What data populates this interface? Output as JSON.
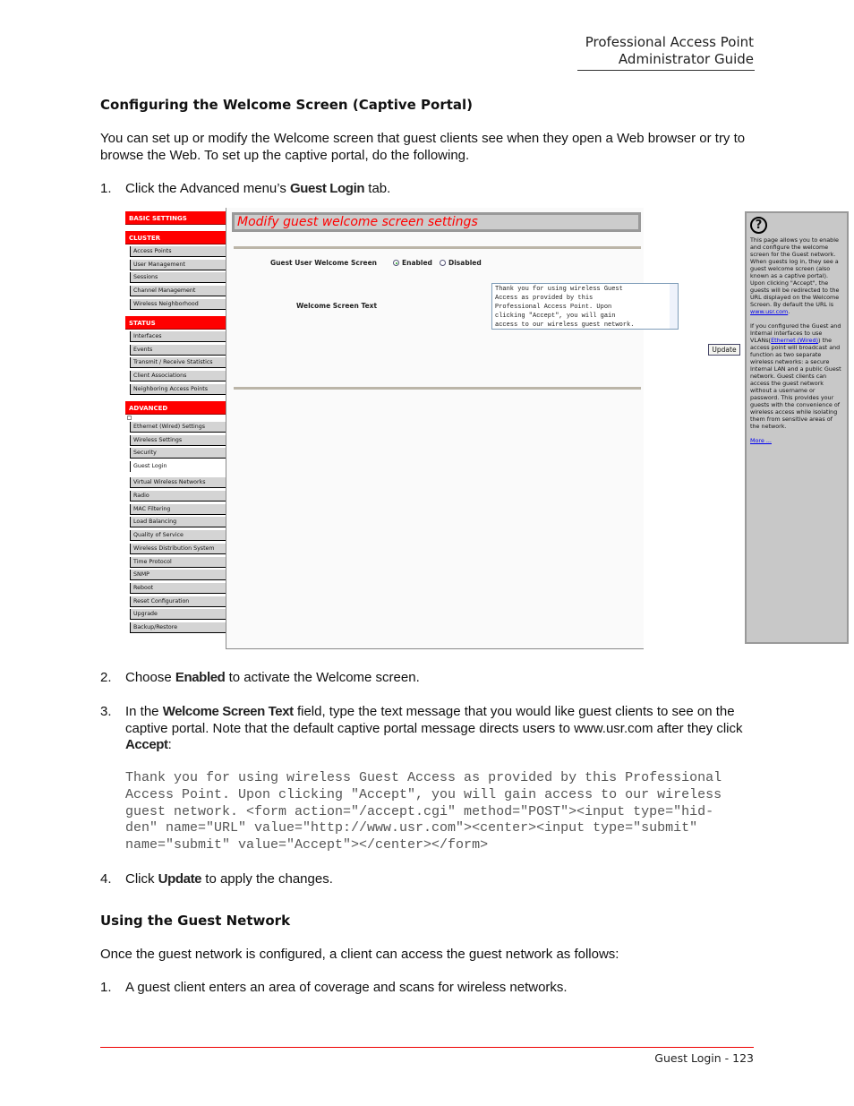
{
  "header": {
    "line1": "Professional Access Point",
    "line2": "Administrator Guide"
  },
  "section1": {
    "title": "Configuring the Welcome Screen (Captive Portal)",
    "intro": "You can set up or modify the Welcome screen that guest clients see when they open a Web browser or try to browse the Web. To set up the captive portal, do the following."
  },
  "steps": [
    {
      "num": "1.",
      "pre": "Click the Advanced menu’s ",
      "kw": "Guest Login",
      "post": " tab."
    },
    {
      "num": "2.",
      "pre": "Choose ",
      "kw": "Enabled",
      "post": " to activate the Welcome screen."
    },
    {
      "num": "3.",
      "pre": "In the ",
      "kw": "Welcome Screen Text",
      "mid": " field, type the text message that you would like guest clients to see on the captive portal. Note that the default captive portal message directs users to www.usr.com after they click ",
      "kw2": "Accept",
      "post": ":"
    },
    {
      "num": "4.",
      "pre": "Click ",
      "kw": "Update",
      "post": " to apply the changes."
    }
  ],
  "code": "Thank you for using wireless Guest Access as provided by this Professional\nAccess Point. Upon clicking \"Accept\", you will gain access to our wireless\nguest network. <form action=\"/accept.cgi\" method=\"POST\"><input type=\"hid-\nden\" name=\"URL\" value=\"http://www.usr.com\"><center><input type=\"submit\"\nname=\"submit\" value=\"Accept\"></center></form>",
  "section2": {
    "title": "Using the Guest Network",
    "intro": "Once the guest network is configured, a client can access the guest network as follows:",
    "step1_num": "1.",
    "step1": "A guest client enters an area of coverage and scans for wireless networks."
  },
  "footer": "Guest Login - 123",
  "screenshot": {
    "sidebar": {
      "basic": "BASIC SETTINGS",
      "cluster": "CLUSTER",
      "cluster_items": [
        "Access Points",
        "User Management",
        "Sessions",
        "Channel Management",
        "Wireless Neighborhood"
      ],
      "status": "STATUS",
      "status_items": [
        "Interfaces",
        "Events",
        "Transmit / Receive Statistics",
        "Client Associations",
        "Neighboring Access Points"
      ],
      "advanced": "ADVANCED",
      "advanced_items": [
        "Ethernet (Wired) Settings",
        "Wireless Settings",
        "Security",
        "Guest Login",
        "Virtual Wireless Networks",
        "Radio",
        "MAC Filtering",
        "Load Balancing",
        "Quality of Service",
        "Wireless Distribution System",
        "Time Protocol",
        "SNMP",
        "Reboot",
        "Reset Configuration",
        "Upgrade",
        "Backup/Restore"
      ],
      "active": "Guest Login"
    },
    "title": "Modify guest welcome screen settings",
    "guest_label": "Guest User Welcome Screen",
    "enabled": "Enabled",
    "disabled": "Disabled",
    "selected": "Enabled",
    "text_label": "Welcome Screen Text",
    "textarea_value": "Thank you for using wireless Guest\nAccess as provided by this\nProfessional Access Point. Upon\nclicking \"Accept\", you will gain\naccess to our wireless guest network.",
    "update": "Update",
    "help": {
      "p1": "This page allows you to enable and configure the welcome screen for the Guest network. When guests log in, they see a guest welcome screen (also known as a captive portal). Upon clicking \"Accept\", the guests will be redirected to the URL displayed on the Welcome Screen. By default the URL is ",
      "link1": "www.usr.com",
      "p1end": ".",
      "p2a": "If you configured the Guest and Internal interfaces to use VLANs(",
      "link2": "Ethernet (Wired)",
      "p2b": ") the access point will broadcast and function as two separate wireless networks: a secure Internal LAN and a public Guest network. Guest clients can access the guest network without a username or password. This provides your guests with the convenience of wireless access while isolating them from sensitive areas of the network.",
      "more": "More ..."
    },
    "colors": {
      "accent": "#ff0000",
      "panel": "#c8c8c8"
    }
  }
}
